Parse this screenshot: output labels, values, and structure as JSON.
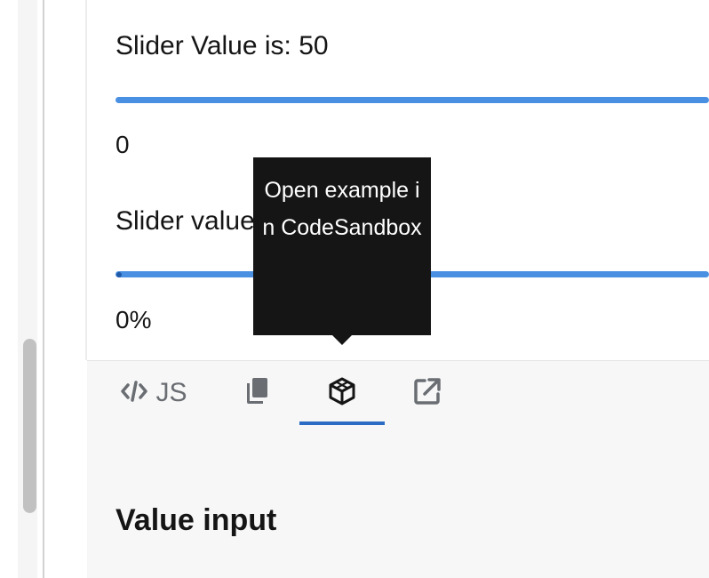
{
  "example": {
    "slider1": {
      "label": "Slider Value is: 50",
      "min_label": "0",
      "value": 50
    },
    "slider2": {
      "label": "Slider value",
      "min_label": "0%",
      "value": 0
    }
  },
  "toolbar": {
    "js_label": "JS",
    "active_tool": "codesandbox"
  },
  "tooltip": {
    "text": "Open example in CodeSandbox"
  },
  "section": {
    "title": "Value input"
  },
  "colors": {
    "accent": "#2b6cc4",
    "track": "#4a90e2",
    "tooltip_bg": "#151515"
  },
  "icons": {
    "code": "code-icon",
    "copy": "copy-icon",
    "codesandbox": "codesandbox-icon",
    "external": "external-link-icon"
  }
}
